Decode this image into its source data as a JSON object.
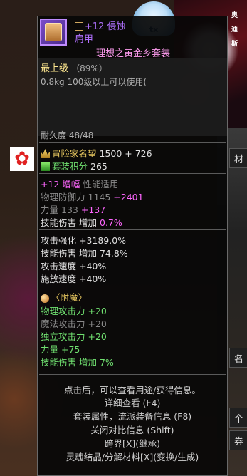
{
  "background": {
    "tab_top": "材",
    "tab_mid": "名",
    "tab_b1": "个",
    "tab_b2": "券",
    "art_text_1": "奥",
    "art_text_2": "迪",
    "art_text_3": "斯",
    "mascot_label": "tx"
  },
  "item": {
    "icon": "armor-icon",
    "upgrade_prefix": "+12",
    "name_part1": "侵蚀",
    "name_part2": "肩甲",
    "set_name": "理想之黄金乡套装",
    "grade": "最上级",
    "grade_percent": "（89%）",
    "weight": "0.8kg",
    "level_req": "100级以上可以使用(",
    "durability": "耐久度 48/48"
  },
  "scores": {
    "adventurer_label": "冒险家名望",
    "adventurer_value": "1500 + 726",
    "set_points_label": "套装积分",
    "set_points_value": "265"
  },
  "amplify": {
    "label": "+12 增幅",
    "type": "性能适用",
    "phys_def_label": "物理防御力",
    "phys_def_base": "1145",
    "phys_def_bonus": "+2401",
    "str_label": "力量",
    "str_base": "133",
    "str_bonus": "+137",
    "skill_dmg_label": "技能伤害",
    "skill_dmg_prefix": "增加",
    "skill_dmg_value": "0.7%"
  },
  "stats": {
    "atk_enhance": "攻击强化 +3189.0%",
    "skill_dmg": "技能伤害 增加 74.8%",
    "atk_speed": "攻击速度 +40%",
    "cast_speed": "施放速度 +40%"
  },
  "enchant": {
    "header": "〈附魔〉",
    "phys_atk": "物理攻击力 +20",
    "mag_atk": "魔法攻击力 +20",
    "ind_atk": "独立攻击力 +20",
    "str": "力量 +75",
    "skill_dmg": "技能伤害 增加 7%"
  },
  "footer": {
    "hint1": "点击后，可以查看用途/获得信息。",
    "hint2": "详细查看 (F4)",
    "hint3": "套装属性，流派装备信息 (F8)",
    "hint4": "关闭对比信息 (Shift)",
    "cross_realm": "跨界[X](继承)",
    "soul": "灵魂结晶/分解材料[X](变换/生成)"
  },
  "colors": {
    "purple_name": "#b070ff",
    "set_pink": "#ff9cf0",
    "stat_green": "#70e070",
    "bonus_pink": "#ff66ff",
    "gold": "#e8c860",
    "orange": "#ff9c40",
    "red": "#ff5050"
  }
}
